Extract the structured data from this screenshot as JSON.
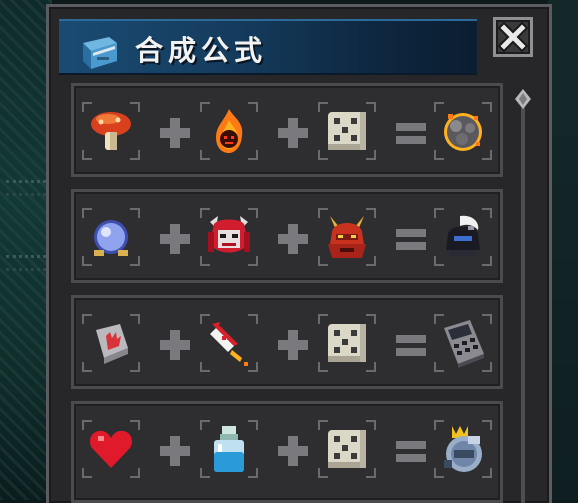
{
  "window": {
    "title": "合成公式"
  },
  "icons": {
    "book": "recipe-book-icon",
    "close": "close-x-icon",
    "plus": "plus-icon",
    "equals": "equals-icon",
    "dice": "random-dice-icon"
  },
  "recipes": [
    {
      "inputs": [
        "mushroom",
        "fire-spirit",
        "dice"
      ],
      "result": "burning-rock-orb"
    },
    {
      "inputs": [
        "crystal-ball",
        "red-oni-mask",
        "samurai-helmet"
      ],
      "result": "white-plume-knight-helmet"
    },
    {
      "inputs": [
        "stone-hand-tile",
        "firework-rocket",
        "dice"
      ],
      "result": "calculator"
    },
    {
      "inputs": [
        "red-heart",
        "potion-bottle",
        "dice"
      ],
      "result": "crowned-engine-globe"
    }
  ],
  "colors": {
    "panel": "#272729",
    "header_blue": "#1a4b73",
    "close_bg": "#3a3a3d"
  }
}
